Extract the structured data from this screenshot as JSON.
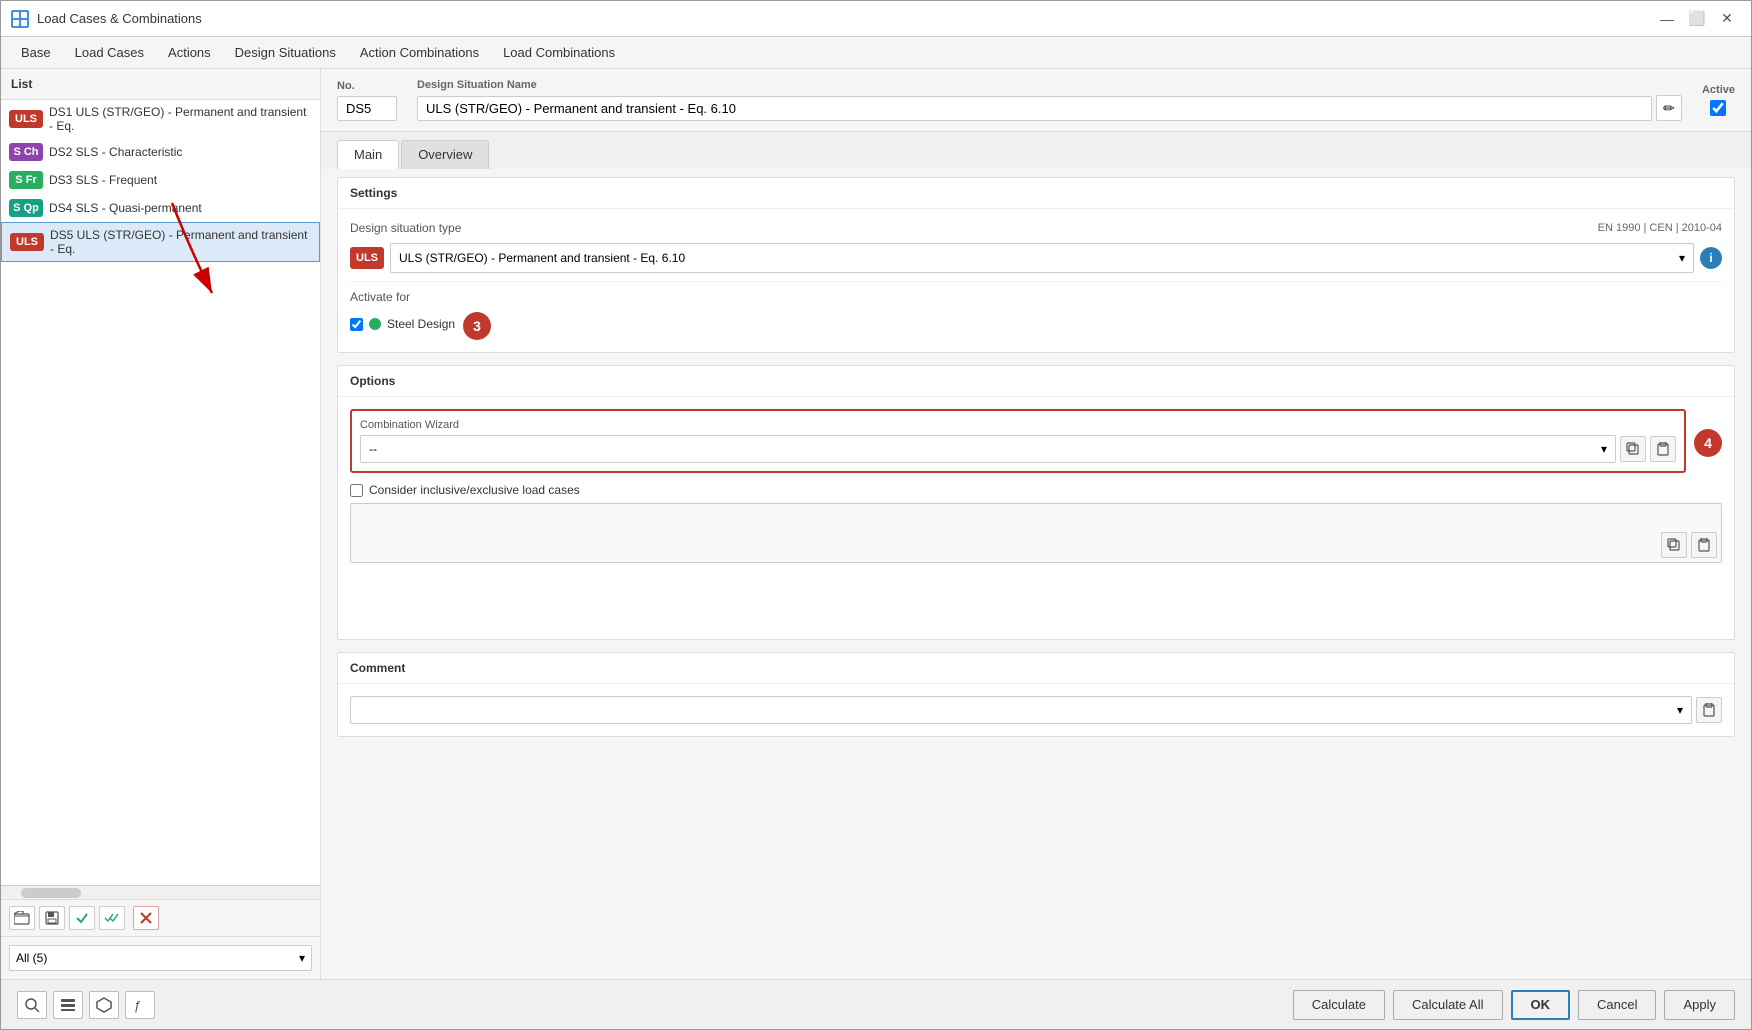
{
  "window": {
    "title": "Load Cases & Combinations",
    "icon": "LC"
  },
  "menu": {
    "items": [
      "Base",
      "Load Cases",
      "Actions",
      "Design Situations",
      "Action Combinations",
      "Load Combinations"
    ]
  },
  "sidebar": {
    "header": "List",
    "items": [
      {
        "badge": "ULS",
        "badge_type": "uls",
        "text": "DS1  ULS (STR/GEO) - Permanent and transient - Eq."
      },
      {
        "badge": "S Ch",
        "badge_type": "sch",
        "text": "DS2  SLS - Characteristic"
      },
      {
        "badge": "S Fr",
        "badge_type": "sfr",
        "text": "DS3  SLS - Frequent"
      },
      {
        "badge": "S Qp",
        "badge_type": "scp",
        "text": "DS4  SLS - Quasi-permanent"
      },
      {
        "badge": "ULS",
        "badge_type": "uls",
        "text": "DS5  ULS (STR/GEO) - Permanent and transient - Eq.",
        "selected": true
      }
    ],
    "filter": "All (5)",
    "toolbar_buttons": [
      "add_folder",
      "save",
      "check",
      "check_all",
      "delete"
    ]
  },
  "design_situation": {
    "no_label": "No.",
    "no_value": "DS5",
    "name_label": "Design Situation Name",
    "name_value": "ULS (STR/GEO) - Permanent and transient - Eq. 6.10",
    "active_label": "Active",
    "active_checked": true
  },
  "tabs": {
    "items": [
      "Main",
      "Overview"
    ],
    "active": "Main"
  },
  "settings": {
    "section_title": "Settings",
    "ds_type_label": "Design situation type",
    "ds_type_standard": "EN 1990 | CEN | 2010-04",
    "ds_type_value": "ULS (STR/GEO) - Permanent and transient - Eq. 6.10",
    "activate_for_label": "Activate for",
    "steel_design_checked": true,
    "steel_design_label": "Steel Design"
  },
  "options": {
    "section_title": "Options",
    "combo_wizard_label": "Combination Wizard",
    "combo_wizard_value": "--",
    "inclusive_label": "Consider inclusive/exclusive load cases",
    "inclusive_checked": false
  },
  "comment": {
    "label": "Comment",
    "value": ""
  },
  "footer": {
    "calculate": "Calculate",
    "calculate_all": "Calculate All",
    "ok": "OK",
    "cancel": "Cancel",
    "apply": "Apply"
  },
  "annotations": {
    "step3": "3",
    "step4": "4"
  }
}
